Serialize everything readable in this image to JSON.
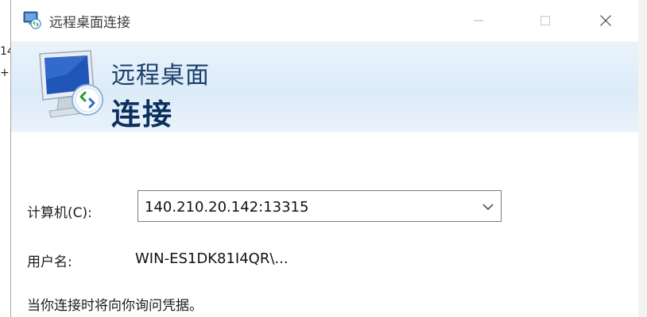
{
  "window": {
    "title": "远程桌面连接"
  },
  "banner": {
    "line1": "远程桌面",
    "line2": "连接"
  },
  "form": {
    "computer_label": "计算机(C):",
    "computer_value": "140.210.20.142:13315",
    "username_label": "用户名:",
    "username_value": "WIN-ES1DK81I4QR\\...",
    "note": "当你连接时将向你询问凭据。"
  },
  "background": {
    "frag1": "14",
    "frag2": "+"
  },
  "icons": {
    "title": "remote-desktop-icon",
    "banner": "remote-desktop-monitor-icon",
    "minimize": "minimize-icon",
    "maximize": "maximize-icon",
    "close": "close-icon",
    "dropdown": "chevron-down-icon"
  },
  "colors": {
    "banner_title": "#0b2f5e",
    "banner_bg": "#dcebf8"
  }
}
